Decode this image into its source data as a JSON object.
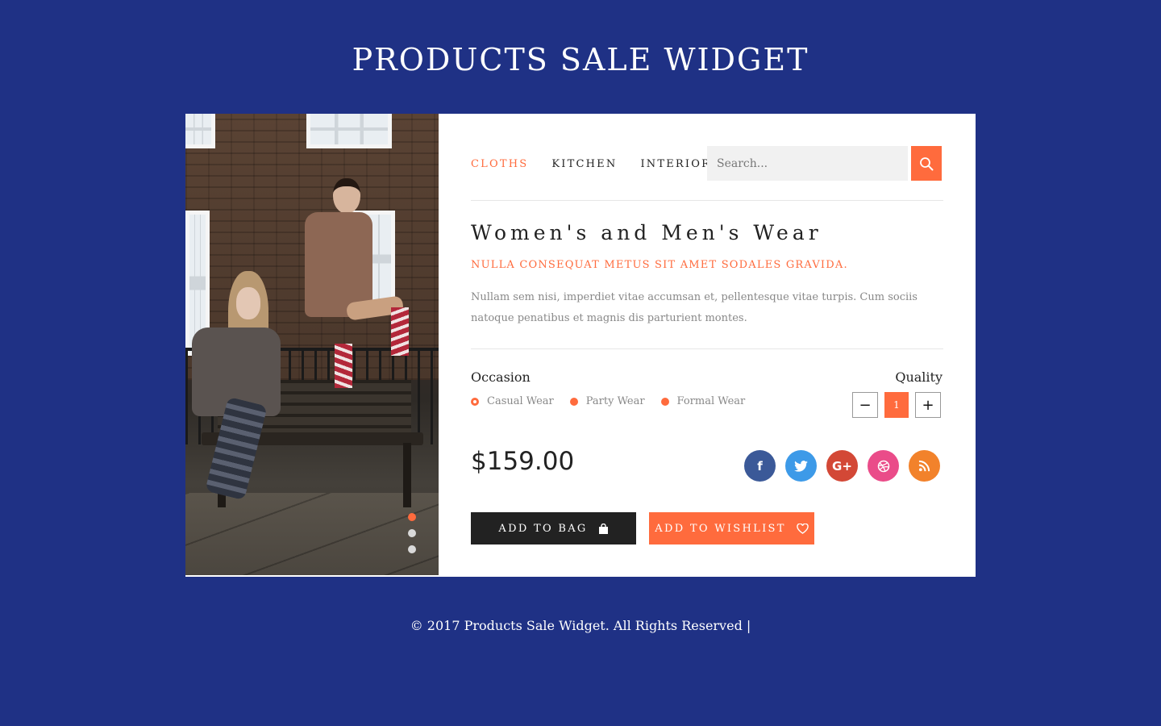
{
  "page": {
    "title": "PRODUCTS SALE WIDGET"
  },
  "nav": {
    "items": [
      {
        "label": "CLOTHS",
        "active": true
      },
      {
        "label": "KITCHEN",
        "active": false
      },
      {
        "label": "INTERIOR",
        "active": false
      }
    ]
  },
  "search": {
    "placeholder": "Search...",
    "value": "",
    "icon": "search-icon"
  },
  "product": {
    "title": "Women's and Men's Wear",
    "subtitle": "NULLA CONSEQUAT METUS SIT AMET SODALES GRAVIDA.",
    "description": "Nullam sem nisi, imperdiet vitae accumsan et, pellentesque vitae turpis. Cum sociis natoque penatibus et magnis dis parturient montes.",
    "price": "$159.00"
  },
  "occasion": {
    "label": "Occasion",
    "options": [
      {
        "label": "Casual Wear",
        "selected": true
      },
      {
        "label": "Party Wear",
        "selected": false
      },
      {
        "label": "Formal Wear",
        "selected": false
      }
    ]
  },
  "quantity": {
    "label": "Quality",
    "value": "1",
    "decrement": "−",
    "increment": "+"
  },
  "social": [
    {
      "name": "facebook-icon",
      "glyph": "f",
      "color": "#3b5998"
    },
    {
      "name": "twitter-icon",
      "glyph": "t",
      "color": "#3d9ae8"
    },
    {
      "name": "google-plus-icon",
      "glyph": "G+",
      "color": "#d34836"
    },
    {
      "name": "dribbble-icon",
      "glyph": "◎",
      "color": "#ea4c89"
    },
    {
      "name": "rss-icon",
      "glyph": "◉",
      "color": "#f2822b"
    }
  ],
  "buttons": {
    "add_to_bag": "ADD TO BAG",
    "add_to_wishlist": "ADD TO WISHLIST"
  },
  "slider": {
    "active_index": 0,
    "count": 3
  },
  "footer": {
    "text": "© 2017 Products Sale Widget. All Rights Reserved |"
  },
  "colors": {
    "background": "#1f3185",
    "accent": "#ff6b3d",
    "dark": "#222222"
  }
}
